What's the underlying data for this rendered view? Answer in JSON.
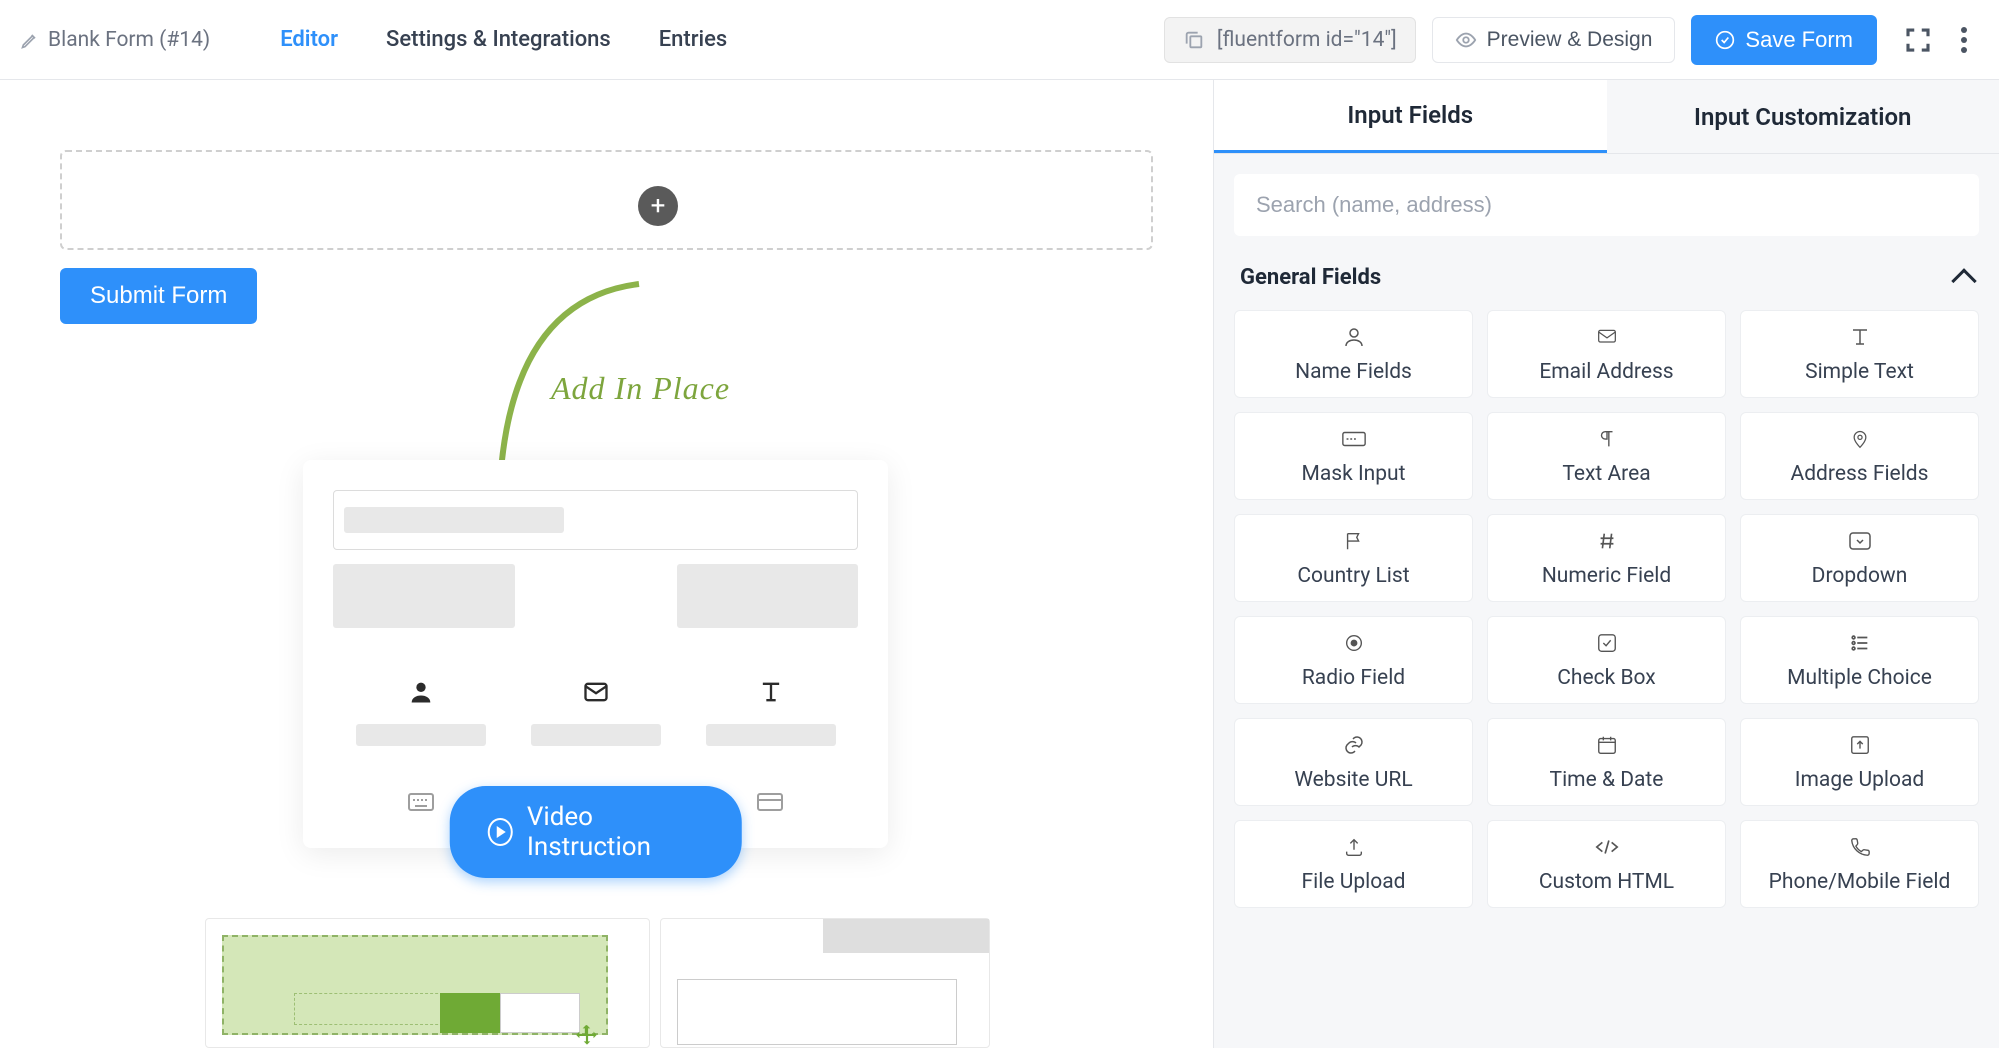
{
  "header": {
    "form_name": "Blank Form (#14)",
    "tabs": {
      "editor": "Editor",
      "settings": "Settings & Integrations",
      "entries": "Entries"
    },
    "shortcode": "[fluentform id=\"14\"]",
    "preview": "Preview & Design",
    "save": "Save Form"
  },
  "canvas": {
    "submit": "Submit Form",
    "add_in_place": "Add In Place",
    "video": "Video Instruction"
  },
  "sidebar": {
    "tabs": {
      "input_fields": "Input Fields",
      "customization": "Input Customization"
    },
    "search_placeholder": "Search (name, address)",
    "section_general": "General Fields",
    "fields": [
      {
        "label": "Name Fields",
        "icon": "user-icon"
      },
      {
        "label": "Email Address",
        "icon": "mail-icon"
      },
      {
        "label": "Simple Text",
        "icon": "text-icon"
      },
      {
        "label": "Mask Input",
        "icon": "mask-icon"
      },
      {
        "label": "Text Area",
        "icon": "paragraph-icon"
      },
      {
        "label": "Address Fields",
        "icon": "pin-icon"
      },
      {
        "label": "Country List",
        "icon": "flag-icon"
      },
      {
        "label": "Numeric Field",
        "icon": "hash-icon"
      },
      {
        "label": "Dropdown",
        "icon": "dropdown-icon"
      },
      {
        "label": "Radio Field",
        "icon": "radio-icon"
      },
      {
        "label": "Check Box",
        "icon": "check-icon"
      },
      {
        "label": "Multiple Choice",
        "icon": "list-icon"
      },
      {
        "label": "Website URL",
        "icon": "link-icon"
      },
      {
        "label": "Time & Date",
        "icon": "calendar-icon"
      },
      {
        "label": "Image Upload",
        "icon": "image-up-icon"
      },
      {
        "label": "File Upload",
        "icon": "upload-icon"
      },
      {
        "label": "Custom HTML",
        "icon": "code-icon"
      },
      {
        "label": "Phone/Mobile Field",
        "icon": "phone-icon"
      }
    ]
  }
}
